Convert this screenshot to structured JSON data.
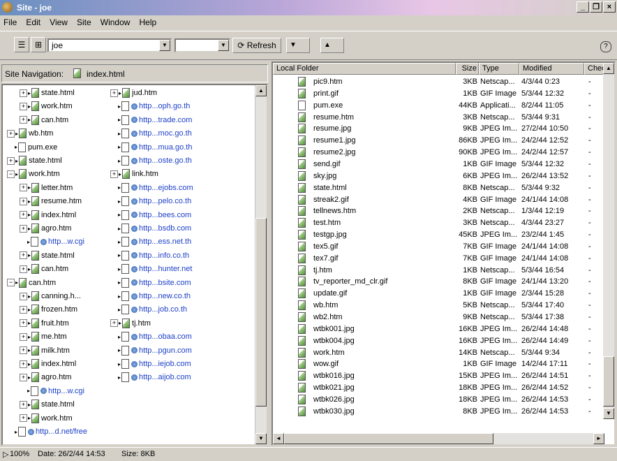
{
  "window": {
    "title": "Site - joe"
  },
  "menu": [
    "File",
    "Edit",
    "View",
    "Site",
    "Window",
    "Help"
  ],
  "toolbar": {
    "site_value": "joe",
    "refresh_label": "Refresh"
  },
  "site_nav": {
    "label": "Site Navigation:",
    "file": "index.html"
  },
  "tree_left": [
    {
      "label": "state.html",
      "type": "doc",
      "exp": "+",
      "indent": 1,
      "link": false
    },
    {
      "label": "work.htm",
      "type": "doc",
      "exp": "+",
      "indent": 1,
      "link": false
    },
    {
      "label": "can.htm",
      "type": "doc",
      "exp": "+",
      "indent": 1,
      "link": false
    },
    {
      "label": "wb.htm",
      "type": "doc",
      "exp": "+",
      "indent": 0,
      "link": false
    },
    {
      "label": "pum.exe",
      "type": "blank",
      "exp": "",
      "indent": 0,
      "link": false
    },
    {
      "label": "state.html",
      "type": "doc",
      "exp": "+",
      "indent": 0,
      "link": false
    },
    {
      "label": "work.htm",
      "type": "doc",
      "exp": "-",
      "indent": 0,
      "link": false
    },
    {
      "label": "letter.htm",
      "type": "doc",
      "exp": "+",
      "indent": 1,
      "link": false
    },
    {
      "label": "resume.htm",
      "type": "doc",
      "exp": "+",
      "indent": 1,
      "link": false
    },
    {
      "label": "index.html",
      "type": "doc",
      "exp": "+",
      "indent": 1,
      "link": false
    },
    {
      "label": "agro.htm",
      "type": "doc",
      "exp": "+",
      "indent": 1,
      "link": false
    },
    {
      "label": "http...w.cgi",
      "type": "blank",
      "exp": "",
      "indent": 1,
      "link": true
    },
    {
      "label": "state.html",
      "type": "doc",
      "exp": "+",
      "indent": 1,
      "link": false
    },
    {
      "label": "can.htm",
      "type": "doc",
      "exp": "+",
      "indent": 1,
      "link": false
    },
    {
      "label": "can.htm",
      "type": "doc",
      "exp": "-",
      "indent": 0,
      "link": false
    },
    {
      "label": "canning.h...",
      "type": "doc",
      "exp": "+",
      "indent": 1,
      "link": false
    },
    {
      "label": "frozen.htm",
      "type": "doc",
      "exp": "+",
      "indent": 1,
      "link": false
    },
    {
      "label": "fruit.htm",
      "type": "doc",
      "exp": "+",
      "indent": 1,
      "link": false
    },
    {
      "label": "me.htm",
      "type": "doc",
      "exp": "+",
      "indent": 1,
      "link": false
    },
    {
      "label": "milk.htm",
      "type": "doc",
      "exp": "+",
      "indent": 1,
      "link": false
    },
    {
      "label": "index.html",
      "type": "doc",
      "exp": "+",
      "indent": 1,
      "link": false
    },
    {
      "label": "agro.htm",
      "type": "doc",
      "exp": "+",
      "indent": 1,
      "link": false
    },
    {
      "label": "http...w.cgi",
      "type": "blank",
      "exp": "",
      "indent": 1,
      "link": true
    },
    {
      "label": "state.html",
      "type": "doc",
      "exp": "+",
      "indent": 1,
      "link": false
    },
    {
      "label": "work.htm",
      "type": "doc",
      "exp": "+",
      "indent": 1,
      "link": false
    },
    {
      "label": "http...d.net/free",
      "type": "blank",
      "exp": "",
      "indent": 0,
      "link": true
    }
  ],
  "tree_right": [
    {
      "label": "jud.htm",
      "type": "doc",
      "exp": "+",
      "link": false
    },
    {
      "label": "http...oph.go.th",
      "type": "blank",
      "exp": "",
      "link": true
    },
    {
      "label": "http...trade.com",
      "type": "blank",
      "exp": "",
      "link": true
    },
    {
      "label": "http...moc.go.th",
      "type": "blank",
      "exp": "",
      "link": true
    },
    {
      "label": "http...mua.go.th",
      "type": "blank",
      "exp": "",
      "link": true
    },
    {
      "label": "http...oste.go.th",
      "type": "blank",
      "exp": "",
      "link": true
    },
    {
      "label": "link.htm",
      "type": "doc",
      "exp": "+",
      "link": false
    },
    {
      "label": "http...ejobs.com",
      "type": "blank",
      "exp": "",
      "link": true
    },
    {
      "label": "http...pelo.co.th",
      "type": "blank",
      "exp": "",
      "link": true
    },
    {
      "label": "http...bees.com",
      "type": "blank",
      "exp": "",
      "link": true
    },
    {
      "label": "http...bsdb.com",
      "type": "blank",
      "exp": "",
      "link": true
    },
    {
      "label": "http...ess.net.th",
      "type": "blank",
      "exp": "",
      "link": true
    },
    {
      "label": "http...info.co.th",
      "type": "blank",
      "exp": "",
      "link": true
    },
    {
      "label": "http...hunter.net",
      "type": "blank",
      "exp": "",
      "link": true
    },
    {
      "label": "http...bsite.com",
      "type": "blank",
      "exp": "",
      "link": true
    },
    {
      "label": "http...new.co.th",
      "type": "blank",
      "exp": "",
      "link": true
    },
    {
      "label": "http...job.co.th",
      "type": "blank",
      "exp": "",
      "link": true
    },
    {
      "label": "tj.htm",
      "type": "doc",
      "exp": "+",
      "link": false
    },
    {
      "label": "http...obaa.com",
      "type": "blank",
      "exp": "",
      "link": true
    },
    {
      "label": "http...pgun.com",
      "type": "blank",
      "exp": "",
      "link": true
    },
    {
      "label": "http...iejob.com",
      "type": "blank",
      "exp": "",
      "link": true
    },
    {
      "label": "http...aijob.com",
      "type": "blank",
      "exp": "",
      "link": true
    }
  ],
  "local_folder": {
    "headers": [
      "Local Folder",
      "Size",
      "Type",
      "Modified",
      "Chec"
    ],
    "rows": [
      [
        "pic9.htm",
        "3KB",
        "Netscap...",
        "4/3/44 0:23",
        "-"
      ],
      [
        "print.gif",
        "1KB",
        "GIF Image",
        "5/3/44 12:32",
        "-"
      ],
      [
        "pum.exe",
        "44KB",
        "Applicati...",
        "8/2/44 11:05",
        "-"
      ],
      [
        "resume.htm",
        "3KB",
        "Netscap...",
        "5/3/44 9:31",
        "-"
      ],
      [
        "resume.jpg",
        "9KB",
        "JPEG Im...",
        "27/2/44 10:50",
        "-"
      ],
      [
        "resume1.jpg",
        "86KB",
        "JPEG Im...",
        "24/2/44 12:52",
        "-"
      ],
      [
        "resume2.jpg",
        "90KB",
        "JPEG Im...",
        "24/2/44 12:57",
        "-"
      ],
      [
        "send.gif",
        "1KB",
        "GIF Image",
        "5/3/44 12:32",
        "-"
      ],
      [
        "sky.jpg",
        "6KB",
        "JPEG Im...",
        "26/2/44 13:52",
        "-"
      ],
      [
        "state.html",
        "8KB",
        "Netscap...",
        "5/3/44 9:32",
        "-"
      ],
      [
        "streak2.gif",
        "4KB",
        "GIF Image",
        "24/1/44 14:08",
        "-"
      ],
      [
        "tellnews.htm",
        "2KB",
        "Netscap...",
        "1/3/44 12:19",
        "-"
      ],
      [
        "test.htm",
        "3KB",
        "Netscap...",
        "4/3/44 23:27",
        "-"
      ],
      [
        "testgp.jpg",
        "45KB",
        "JPEG Im...",
        "23/2/44 1:45",
        "-"
      ],
      [
        "tex5.gif",
        "7KB",
        "GIF Image",
        "24/1/44 14:08",
        "-"
      ],
      [
        "tex7.gif",
        "7KB",
        "GIF Image",
        "24/1/44 14:08",
        "-"
      ],
      [
        "tj.htm",
        "1KB",
        "Netscap...",
        "5/3/44 16:54",
        "-"
      ],
      [
        "tv_reporter_md_clr.gif",
        "8KB",
        "GIF Image",
        "24/1/44 13:20",
        "-"
      ],
      [
        "update.gif",
        "1KB",
        "GIF Image",
        "2/3/44 15:28",
        "-"
      ],
      [
        "wb.htm",
        "5KB",
        "Netscap...",
        "5/3/44 17:40",
        "-"
      ],
      [
        "wb2.htm",
        "9KB",
        "Netscap...",
        "5/3/44 17:38",
        "-"
      ],
      [
        "wtbk001.jpg",
        "16KB",
        "JPEG Im...",
        "26/2/44 14:48",
        "-"
      ],
      [
        "wtbk004.jpg",
        "16KB",
        "JPEG Im...",
        "26/2/44 14:49",
        "-"
      ],
      [
        "work.htm",
        "14KB",
        "Netscap...",
        "5/3/44 9:34",
        "-"
      ],
      [
        "wow.gif",
        "1KB",
        "GIF Image",
        "14/2/44 17:11",
        "-"
      ],
      [
        "wtbk016.jpg",
        "15KB",
        "JPEG Im...",
        "26/2/44 14:51",
        "-"
      ],
      [
        "wtbk021.jpg",
        "18KB",
        "JPEG Im...",
        "26/2/44 14:52",
        "-"
      ],
      [
        "wtbk026.jpg",
        "18KB",
        "JPEG Im...",
        "26/2/44 14:53",
        "-"
      ],
      [
        "wtbk030.jpg",
        "8KB",
        "JPEG Im...",
        "26/2/44 14:53",
        "-"
      ]
    ]
  },
  "status": {
    "zoom": "100%",
    "date": "Date: 26/2/44 14:53",
    "size": "Size: 8KB"
  }
}
